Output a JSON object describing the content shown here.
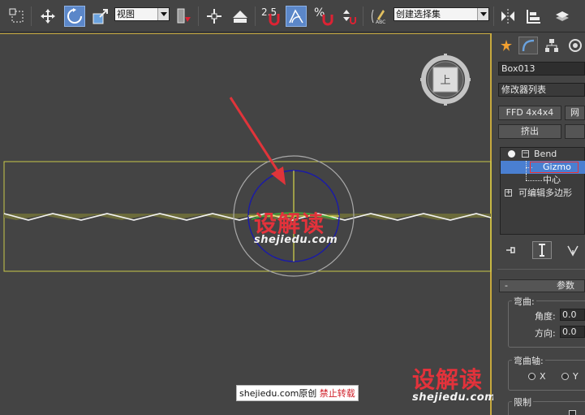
{
  "toolbar": {
    "view_dropdown": "视图",
    "snap_angle_label": "2.5",
    "percent_label": "%",
    "selection_set_dropdown": "创建选择集"
  },
  "viewport": {
    "watermark_center_brand": "设解读",
    "watermark_center_url": "shejiedu.com",
    "watermark_right_brand": "设解读",
    "watermark_right_url": "shejiedu.com",
    "copyright_site": "shejiedu.com原创",
    "copyright_notice": "禁止转载",
    "colors": {
      "selection_box": "#c9c94a",
      "gizmo_circle": "#1a1aa8",
      "outer_circle": "#a8a8a8",
      "mesh_fill": "#6b6b3b",
      "arrow": "#e0343a"
    }
  },
  "viewcube": {
    "face_label": "上"
  },
  "panel": {
    "object_name": "Box013",
    "modifier_list": "修改器列表",
    "ffd_button": "FFD 4x4x4",
    "ffd_button_right": "网",
    "extrude_button": "挤出",
    "stack": [
      {
        "label": "Bend",
        "level": 0
      },
      {
        "label": "Gizmo",
        "level": 1,
        "selected": true
      },
      {
        "label": "中心",
        "level": 1
      },
      {
        "label": "可编辑多边形",
        "level": 0
      }
    ],
    "params": {
      "rollout_minus": "-",
      "rollout_title": "参数",
      "bend_group": "弯曲:",
      "angle_label": "角度:",
      "angle_value": "0.0",
      "direction_label": "方向:",
      "direction_value": "0.0",
      "axis_group": "弯曲轴:",
      "axis_x": "X",
      "axis_y": "Y",
      "limit_group": "限制"
    }
  }
}
